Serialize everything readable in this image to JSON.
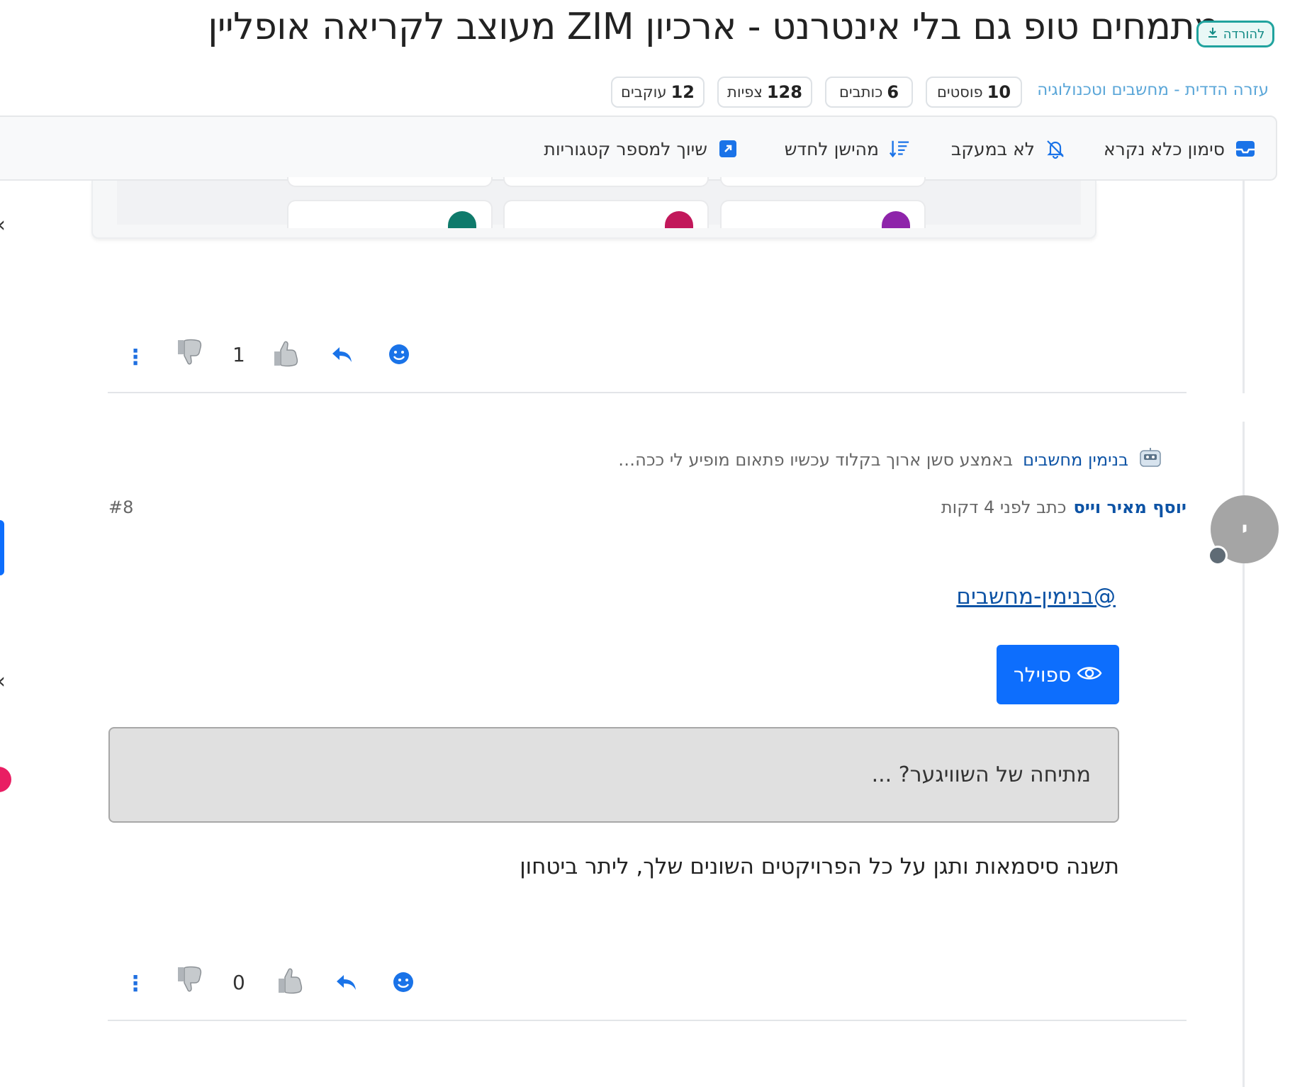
{
  "topic": {
    "title": "מתמחים טופ גם בלי אינטרנט - ארכיון ZIM מעוצב לקריאה אופליין",
    "badge_label": "להורדה",
    "category": "עזרה הדדית - מחשבים וטכנולוגיה"
  },
  "stats": [
    {
      "value": "10",
      "label": "פוסטים"
    },
    {
      "value": "6",
      "label": "כותבים"
    },
    {
      "value": "128",
      "label": "צפיות"
    },
    {
      "value": "12",
      "label": "עוקבים"
    }
  ],
  "toolbar": {
    "mark_read": "סימון כלא נקרא",
    "not_tracking": "לא במעקב",
    "sort": "מהישן לחדש",
    "assign": "שיוך למספר קטגוריות"
  },
  "post_previous": {
    "upvote_count": "1"
  },
  "post": {
    "reply_to_user": "בנימין מחשבים",
    "reply_to_excerpt": "באמצע סשן ארוך בקלוד עכשיו פתאום מופיע לי ככה…",
    "author": "יוסף מאיר וייס",
    "wrote_text": "כתב לפני 4 דקות",
    "index": "#8",
    "avatar_letter": "י",
    "mention": "@בנימין-מחשבים",
    "spoiler_label": "ספוילר",
    "spoiler_content": "מתיחה של השוויגער? ...",
    "body": "תשנה סיסמאות ותגן על כל הפרויקטים השונים שלך, ליתר ביטחון",
    "upvote_count": "0"
  },
  "colors": {
    "accent": "#0d6efd",
    "link": "#0d53a5",
    "badge_border": "#20a39e"
  }
}
